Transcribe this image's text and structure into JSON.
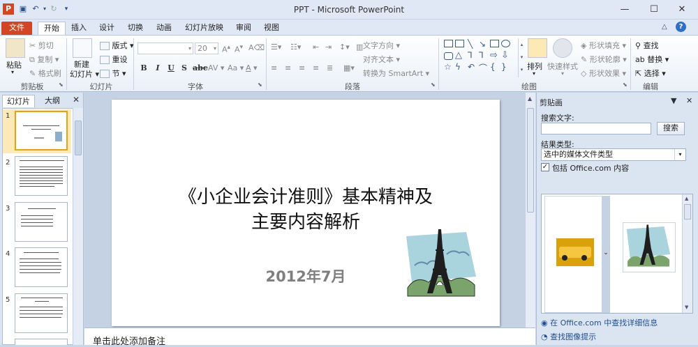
{
  "window": {
    "title": "PPT - Microsoft PowerPoint",
    "app_icon": "P",
    "help": "?"
  },
  "tabs": [
    {
      "label": "文件"
    },
    {
      "label": "开始"
    },
    {
      "label": "插入"
    },
    {
      "label": "设计"
    },
    {
      "label": "切换"
    },
    {
      "label": "动画"
    },
    {
      "label": "幻灯片放映"
    },
    {
      "label": "审阅"
    },
    {
      "label": "视图"
    }
  ],
  "ribbon": {
    "clipboard": {
      "paste": "粘贴",
      "cut": "剪切",
      "copy": "复制",
      "format_painter": "格式刷",
      "group": "剪贴板"
    },
    "slides": {
      "new_slide": "新建",
      "new_slide2": "幻灯片",
      "layout": "版式",
      "reset": "重设",
      "section": "节",
      "group": "幻灯片"
    },
    "font": {
      "size": "20",
      "group": "字体"
    },
    "paragraph": {
      "text_direction": "文字方向",
      "align_text": "对齐文本",
      "smartart": "转换为 SmartArt",
      "group": "段落"
    },
    "drawing": {
      "arrange": "排列",
      "quick_styles": "快速样式",
      "shape_fill": "形状填充",
      "shape_outline": "形状轮廓",
      "shape_effects": "形状效果",
      "group": "绘图"
    },
    "editing": {
      "find": "查找",
      "replace": "替换",
      "select": "选择",
      "group": "编辑"
    }
  },
  "left_pane": {
    "tab_slides": "幻灯片",
    "tab_outline": "大纲",
    "close": "✕",
    "thumbnails": [
      {
        "num": "1"
      },
      {
        "num": "2"
      },
      {
        "num": "3"
      },
      {
        "num": "4"
      },
      {
        "num": "5"
      }
    ]
  },
  "slide": {
    "title_line1": "《小企业会计准则》基本精神及",
    "title_line2": "主要内容解析",
    "subtitle": "2012年7月"
  },
  "notes": {
    "placeholder": "单击此处添加备注"
  },
  "clip_pane": {
    "title": "剪贴画",
    "search_label": "搜索文字:",
    "search_value": "",
    "search_button": "搜索",
    "results_label": "结果类型:",
    "results_value": "选中的媒体文件类型",
    "include_office": "包括 Office.com 内容",
    "include_checked": true,
    "bottom_link1": "在 Office.com 中查找详细信息",
    "bottom_link2": "查找图像提示"
  },
  "colors": {
    "file_tab": "#d24625",
    "ribbon_bg": "#eaf0f8",
    "pane_bg": "#dbe4f1",
    "selected_thumb": "#e3a21a"
  }
}
